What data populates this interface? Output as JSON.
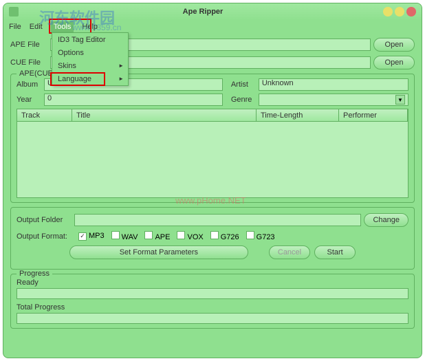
{
  "window": {
    "title": "Ape Ripper"
  },
  "watermarks": {
    "main": "河东软件园",
    "sub": "www.0359.cn",
    "center": "www.pHome.NET"
  },
  "menubar": {
    "file": "File",
    "edit": "Edit",
    "tools": "Tools",
    "help": "Help"
  },
  "dropdown": {
    "id3": "ID3 Tag Editor",
    "options": "Options",
    "skins": "Skins",
    "language": "Language"
  },
  "labels": {
    "apeFile": "APE File",
    "cueFile": "CUE File",
    "apeCue": "APE(CUE)",
    "album": "Album",
    "artist": "Artist",
    "year": "Year",
    "genre": "Genre",
    "outputFolder": "Output Folder",
    "outputFormat": "Output Format:",
    "progress": "Progress",
    "ready": "Ready",
    "totalProgress": "Total Progress"
  },
  "values": {
    "album": "Unknown",
    "artist": "Unknown",
    "year": "0",
    "genre": ""
  },
  "table": {
    "track": "Track",
    "title": "Title",
    "timeLength": "Time-Length",
    "performer": "Performer"
  },
  "buttons": {
    "open": "Open",
    "change": "Change",
    "setParams": "Set Format Parameters",
    "cancel": "Cancel",
    "start": "Start"
  },
  "formats": {
    "mp3": "MP3",
    "wav": "WAV",
    "ape": "APE",
    "vox": "VOX",
    "g726": "G726",
    "g723": "G723"
  }
}
